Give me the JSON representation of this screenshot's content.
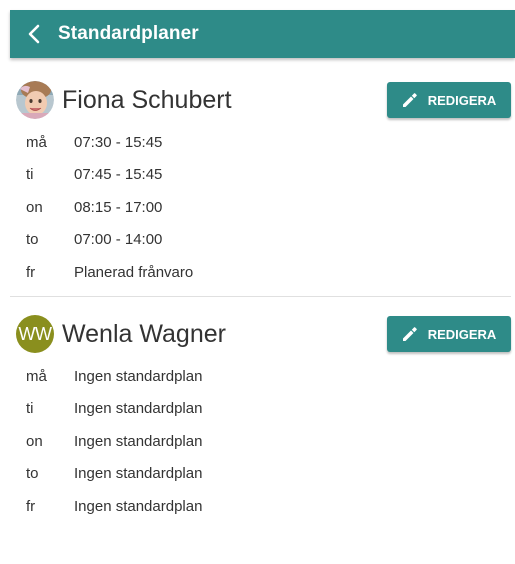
{
  "app_bar": {
    "title": "Standardplaner"
  },
  "colors": {
    "primary": "#2e8b88",
    "initials_avatar": "#8a8f1e"
  },
  "plans": [
    {
      "name": "Fiona Schubert",
      "avatar": {
        "type": "photo",
        "initials": ""
      },
      "edit_label": "REDIGERA",
      "schedule": [
        {
          "day": "må",
          "value": "07:30 - 15:45"
        },
        {
          "day": "ti",
          "value": "07:45 - 15:45"
        },
        {
          "day": "on",
          "value": "08:15 - 17:00"
        },
        {
          "day": "to",
          "value": "07:00 - 14:00"
        },
        {
          "day": "fr",
          "value": "Planerad frånvaro"
        }
      ]
    },
    {
      "name": "Wenla Wagner",
      "avatar": {
        "type": "initials",
        "initials": "WW"
      },
      "edit_label": "REDIGERA",
      "schedule": [
        {
          "day": "må",
          "value": "Ingen standardplan"
        },
        {
          "day": "ti",
          "value": "Ingen standardplan"
        },
        {
          "day": "on",
          "value": "Ingen standardplan"
        },
        {
          "day": "to",
          "value": "Ingen standardplan"
        },
        {
          "day": "fr",
          "value": "Ingen standardplan"
        }
      ]
    }
  ]
}
